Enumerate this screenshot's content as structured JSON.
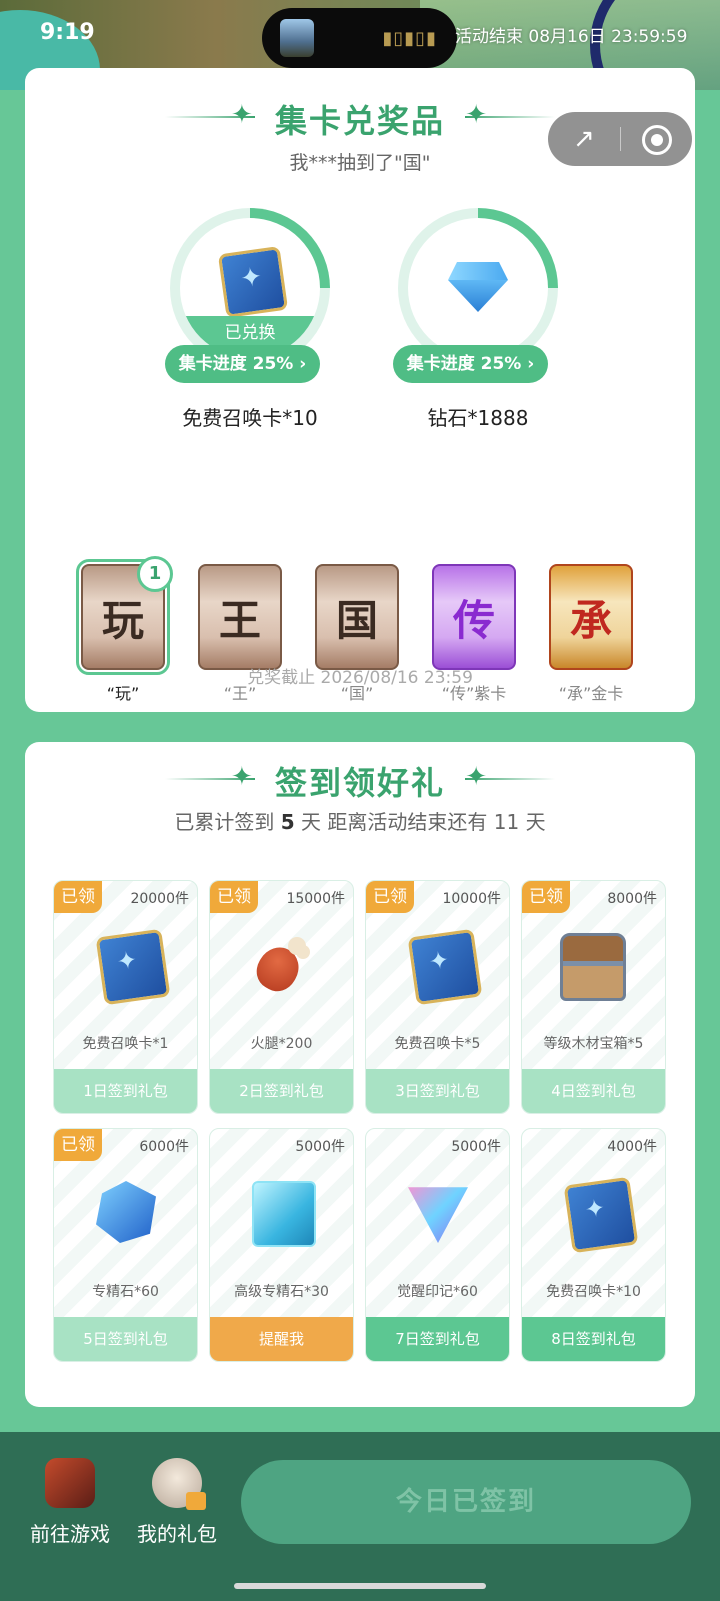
{
  "status_bar": {
    "time": "9:19",
    "right_text": "活动结束 08月16日 23:59:59"
  },
  "collect": {
    "title": "集卡兑奖品",
    "subtitle": "我***抽到了\"国\"",
    "prizes": [
      {
        "name": "免费召唤卡*10",
        "progress": "集卡进度 25%",
        "status": "已兑换",
        "icon": "summon-card-icon",
        "progress_value": 0.25
      },
      {
        "name": "钻石*1888",
        "progress": "集卡进度 25%",
        "status": "",
        "icon": "diamond-icon",
        "progress_value": 0.25
      }
    ],
    "cards": [
      {
        "glyph": "玩",
        "label": "“玩”",
        "count": "1",
        "style": "plain",
        "active": true
      },
      {
        "glyph": "王",
        "label": "“王”",
        "count": "",
        "style": "plain",
        "active": false
      },
      {
        "glyph": "国",
        "label": "“国”",
        "count": "",
        "style": "plain",
        "active": false
      },
      {
        "glyph": "传",
        "label": "“传”紫卡",
        "count": "",
        "style": "purple",
        "active": false
      },
      {
        "glyph": "承",
        "label": "“承”金卡",
        "count": "",
        "style": "gold",
        "active": false
      }
    ],
    "deadline": "兑奖截止 2026/08/16 23:59"
  },
  "signin": {
    "title": "签到领好礼",
    "summary_prefix": "已累计签到",
    "days_signed": "5",
    "summary_mid": "天  距离活动结束还有",
    "days_left": "11",
    "summary_suffix": "天",
    "claimed_label": "已领",
    "items": [
      {
        "qty": "20000件",
        "reward": "免费召唤卡*1",
        "button": "1日签到礼包",
        "claimed": true,
        "state": "done",
        "icon": "summon-card-icon"
      },
      {
        "qty": "15000件",
        "reward": "火腿*200",
        "button": "2日签到礼包",
        "claimed": true,
        "state": "done",
        "icon": "ham-icon"
      },
      {
        "qty": "10000件",
        "reward": "免费召唤卡*5",
        "button": "3日签到礼包",
        "claimed": true,
        "state": "done",
        "icon": "summon-card-icon"
      },
      {
        "qty": "8000件",
        "reward": "等级木材宝箱*5",
        "button": "4日签到礼包",
        "claimed": true,
        "state": "done",
        "icon": "treasure-chest-icon"
      },
      {
        "qty": "6000件",
        "reward": "专精石*60",
        "button": "5日签到礼包",
        "claimed": true,
        "state": "done",
        "icon": "gem-icon"
      },
      {
        "qty": "5000件",
        "reward": "高级专精石*30",
        "button": "提醒我",
        "claimed": false,
        "state": "remind",
        "icon": "crystal-icon"
      },
      {
        "qty": "5000件",
        "reward": "觉醒印记*60",
        "button": "7日签到礼包",
        "claimed": false,
        "state": "active",
        "icon": "shield-icon"
      },
      {
        "qty": "4000件",
        "reward": "免费召唤卡*10",
        "button": "8日签到礼包",
        "claimed": false,
        "state": "active",
        "icon": "summon-card-icon"
      }
    ]
  },
  "bottom_nav": {
    "game_label": "前往游戏",
    "gift_label": "我的礼包",
    "signin_button": "今日已签到"
  },
  "colors": {
    "accent": "#3aa36e",
    "background": "#67c797",
    "claimed_badge": "#f0a93a",
    "bottom_bar": "#2f6e55"
  }
}
